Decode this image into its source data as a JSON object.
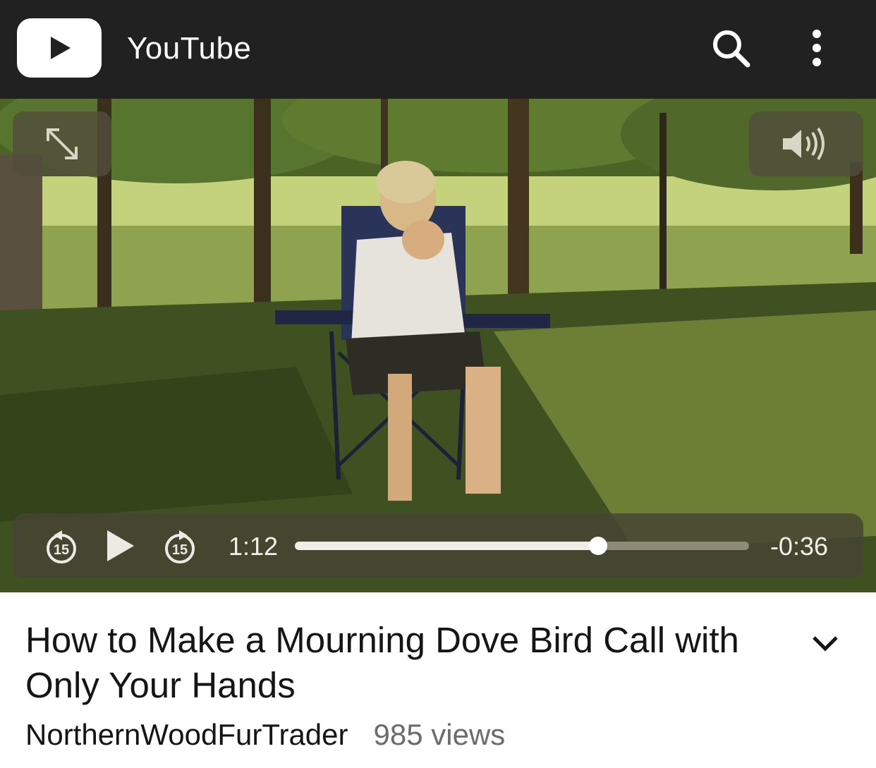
{
  "appbar": {
    "logo_icon": "youtube-play-logo",
    "title": "YouTube",
    "search_icon": "search-icon",
    "more_icon": "more-vert-icon"
  },
  "player": {
    "fullscreen_icon": "fullscreen-arrows-icon",
    "volume_icon": "volume-icon",
    "skip_back_label": "15",
    "skip_forward_label": "15",
    "play_icon": "play-icon",
    "elapsed": "1:12",
    "remaining": "-0:36",
    "progress_fraction": 0.667
  },
  "video": {
    "title": "How to Make a Mourning Dove Bird Call with Only Your Hands",
    "channel": "NorthernWoodFurTrader",
    "views": "985 views",
    "expand_icon": "chevron-down-icon"
  },
  "colors": {
    "appbar_bg": "#212121",
    "control_bg": "#464432",
    "text_primary": "#151515",
    "text_secondary": "#6b6b6b"
  }
}
